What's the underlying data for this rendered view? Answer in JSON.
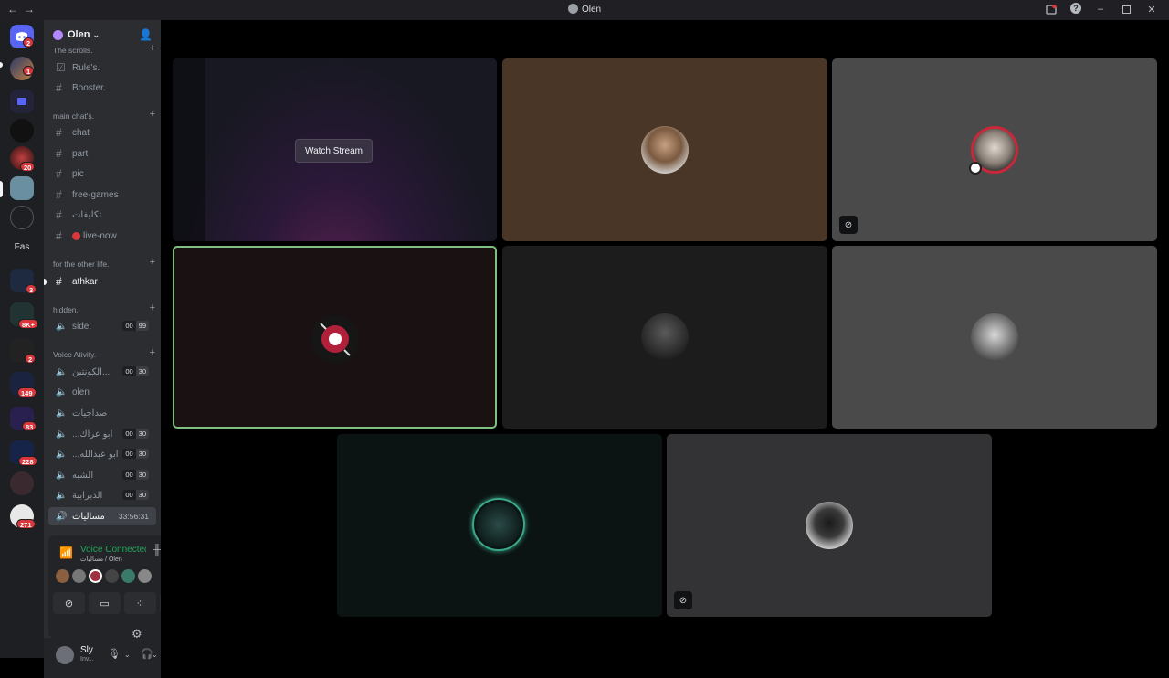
{
  "window": {
    "title": "Olen",
    "help": "?"
  },
  "server_badges": [
    "2",
    "1",
    "20",
    "3",
    "8K+",
    "2",
    "149",
    "83",
    "228",
    "271"
  ],
  "server_labels": {
    "fas": "Fas"
  },
  "guild": {
    "name": "Olen"
  },
  "categories": {
    "scrolls": "The scrolls.",
    "main": "main chat's.",
    "other": "for the other life.",
    "hidden": "hidden.",
    "voice": "Voice Ativity."
  },
  "channels": {
    "rules": "Rule's.",
    "booster": "Booster.",
    "chat": "chat",
    "part": "part",
    "pic": "pic",
    "free_games": "free-games",
    "arabic1": "تكليفات",
    "live_now": "live-now",
    "athkar": "athkar",
    "side": "side.",
    "vc1": "الكونتين...",
    "olen": "olen",
    "vc3": "صداجيات",
    "vc4": "...ابو عراك",
    "vc5": "...ابو عبدالله",
    "vc6": "الشبه",
    "vc7": "الدبرابية",
    "active": "مساليات"
  },
  "counts": {
    "side": [
      "00",
      "99"
    ],
    "vc1": [
      "00",
      "30"
    ],
    "vc4": [
      "00",
      "30"
    ],
    "vc5": [
      "00",
      "30"
    ],
    "vc6": [
      "00",
      "30"
    ],
    "vc7": [
      "00",
      "30"
    ]
  },
  "active_timer": "33:56:31",
  "voice": {
    "title": "Voice Connected",
    "sub": "مساليات / Olen"
  },
  "user": {
    "name": "Sly",
    "status": "Inv..."
  },
  "stream": {
    "watch_label": "Watch Stream"
  },
  "colors": {
    "accent": "#23a55a",
    "badge": "#da373c",
    "speaking_border": "#7fbf7f"
  }
}
